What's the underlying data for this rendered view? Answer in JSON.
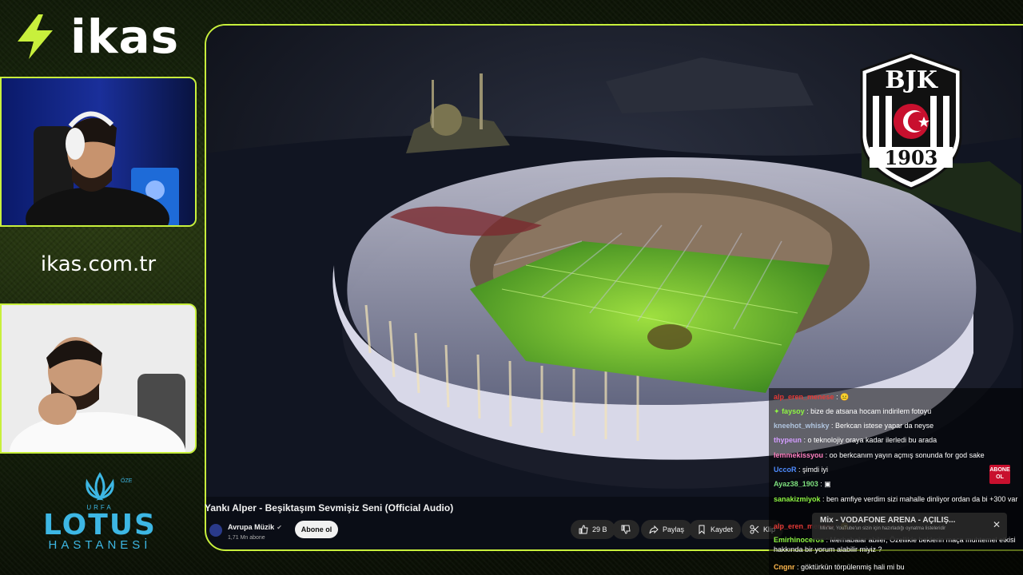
{
  "sponsor": {
    "brand_name": "ikas",
    "website": "ikas.com.tr",
    "hospital": {
      "top": "ÖZEL",
      "city": "URFA",
      "name": "LOTUS",
      "sub": "HASTANESİ"
    }
  },
  "crest": {
    "letters": "BJK",
    "year": "1903"
  },
  "video": {
    "title": "Yankı Alper - Beşiktaşım Sevmişiz Seni (Official Audio)",
    "channel": "Avrupa Müzik",
    "subscribers": "1,71 Mn abone",
    "subscribe_label": "Abone ol",
    "likes": "29 B",
    "share_label": "Paylaş",
    "save_label": "Kaydet",
    "clip_label": "Klip"
  },
  "chat": {
    "messages": [
      {
        "user": "alp_eren_menese",
        "text": ":",
        "emote": "😐",
        "color": "#e53935"
      },
      {
        "user": "faysoy",
        "text": ": bize de atsana hocam indirilem fotoyu",
        "color": "#8ef542"
      },
      {
        "user": "kneehot_whisky",
        "text": ": Berkcan istese yapar da neyse",
        "color": "#b0c4de"
      },
      {
        "user": "thypeun",
        "text": ": o teknolojiy oraya kadar ilerledi bu arada",
        "color": "#d39cff"
      },
      {
        "user": "lemmekissyou",
        "text": ": oo berkcanım yayın açmış sonunda for god sake",
        "color": "#ff80c0"
      },
      {
        "user": "UccoR",
        "text": ": şimdi iyi",
        "color": "#4f8cff"
      },
      {
        "user": "Ayaz38_1903",
        "text": ":",
        "emote": "▣",
        "color": "#7ee07e"
      },
      {
        "user": "sanakizmiyok",
        "text": ": ben amfiye verdim sizi mahalle dinliyor ordan da bi +300 var",
        "color": "#8ef542"
      },
      {
        "user": "alp_eren_menese",
        "text": ":",
        "emote": "😐",
        "color": "#e53935"
      },
      {
        "user": "Emirhinoceros",
        "text": ": Merhabalar abiler, Özellikle beklerin maça muhtemel etkisi hakkında bir yorum alabilir miyiz ?",
        "color": "#8ef542"
      },
      {
        "user": "Cngnr",
        "text": ": göktürkün törpülenmiş hali mi bu",
        "color": "#ffb84d"
      }
    ],
    "badge": "ABONE OL",
    "mix_title": "Mix - VODAFONE ARENA - AÇILIŞ...",
    "mix_sub": "Mix'ler, YouTube'un sizin için hazırladığı oynatma listeleridir",
    "mix_close": "✕"
  },
  "colors": {
    "accent": "#c8f03c",
    "lotus": "#3db7e4"
  }
}
